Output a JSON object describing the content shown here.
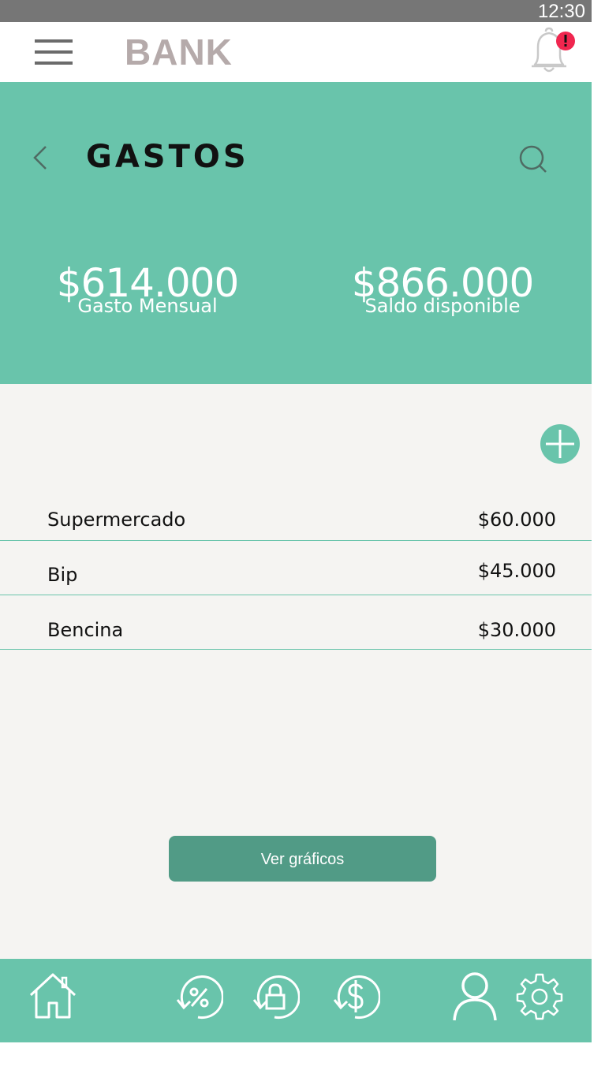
{
  "status_bar": {
    "time": "12:30"
  },
  "app_bar": {
    "brand": "BANK",
    "menu_icon": "hamburger-icon",
    "notification_icon": "bell-icon",
    "notification_badge": "!",
    "colors": {
      "brand_text": "#b5aaaa",
      "badge": "#f0264f"
    }
  },
  "header": {
    "title": "GASTOS",
    "back_icon": "chevron-left-icon",
    "search_icon": "search-icon",
    "summary": [
      {
        "amount": "$614.000",
        "label": "Gasto Mensual"
      },
      {
        "amount": "$866.000",
        "label": "Saldo disponible"
      }
    ],
    "colors": {
      "background": "#69c4ab"
    }
  },
  "expenses": {
    "add_icon": "plus-circle-icon",
    "items": [
      {
        "name": "Supermercado",
        "amount": "$60.000"
      },
      {
        "name": "Bip",
        "amount": "$45.000"
      },
      {
        "name": "Bencina",
        "amount": "$30.000"
      }
    ],
    "cta_label": "Ver gráficos",
    "colors": {
      "cta": "#519b86",
      "divider": "#69c4ab",
      "background": "#f5f4f2"
    }
  },
  "bottom_nav": {
    "items": [
      {
        "icon": "home-icon"
      },
      {
        "icon": "percent-refresh-icon"
      },
      {
        "icon": "lock-refresh-icon"
      },
      {
        "icon": "dollar-refresh-icon"
      },
      {
        "icon": "user-icon"
      },
      {
        "icon": "settings-gear-icon"
      }
    ]
  }
}
